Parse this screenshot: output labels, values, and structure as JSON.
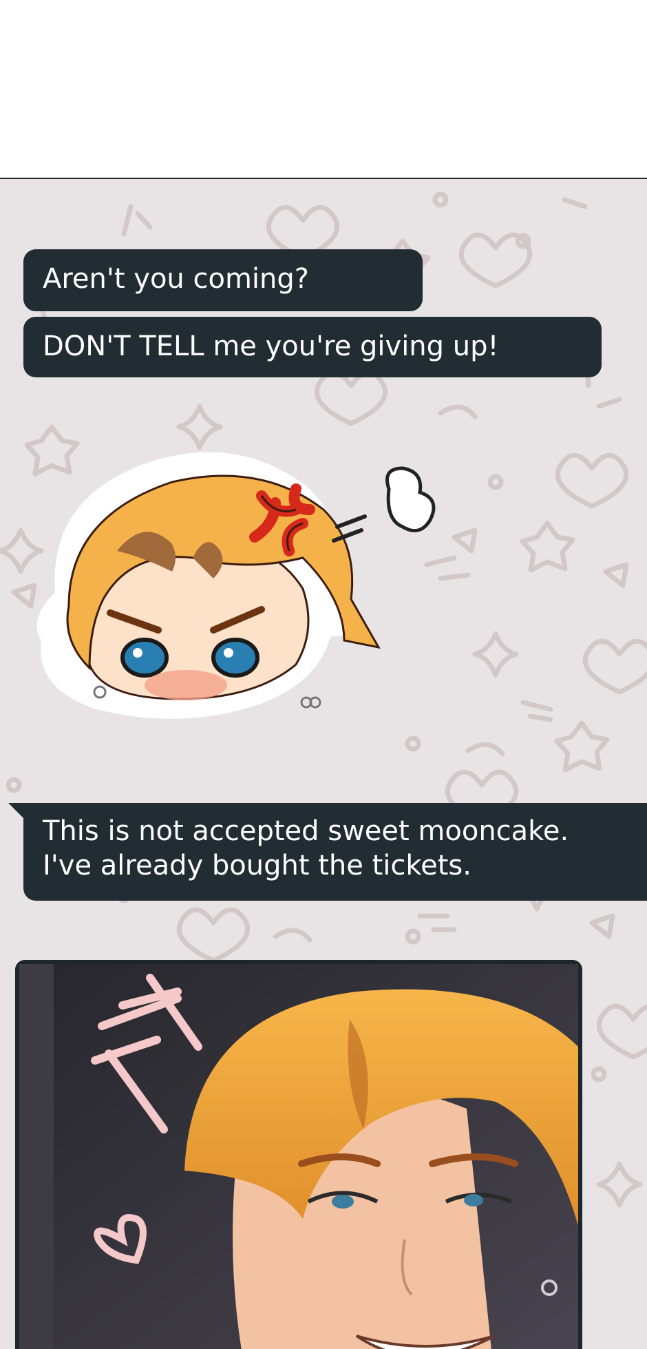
{
  "chat": {
    "messages": [
      {
        "text": "Aren't you coming?"
      },
      {
        "text": "DON'T TELL me you're giving up!"
      },
      {
        "lines": [
          "This is not accepted sweet mooncake.",
          "I've already bought the tickets."
        ]
      }
    ],
    "sticker": {
      "icon": "angry-chibi-sticker",
      "anger_color": "#d6281b",
      "hair_color": "#f6b24a"
    },
    "photo": {
      "icon": "smiling-character-photo"
    }
  },
  "colors": {
    "bubble": "#212c33",
    "chat_background": "#e8e4e5",
    "pattern": "#d3c7ca"
  }
}
